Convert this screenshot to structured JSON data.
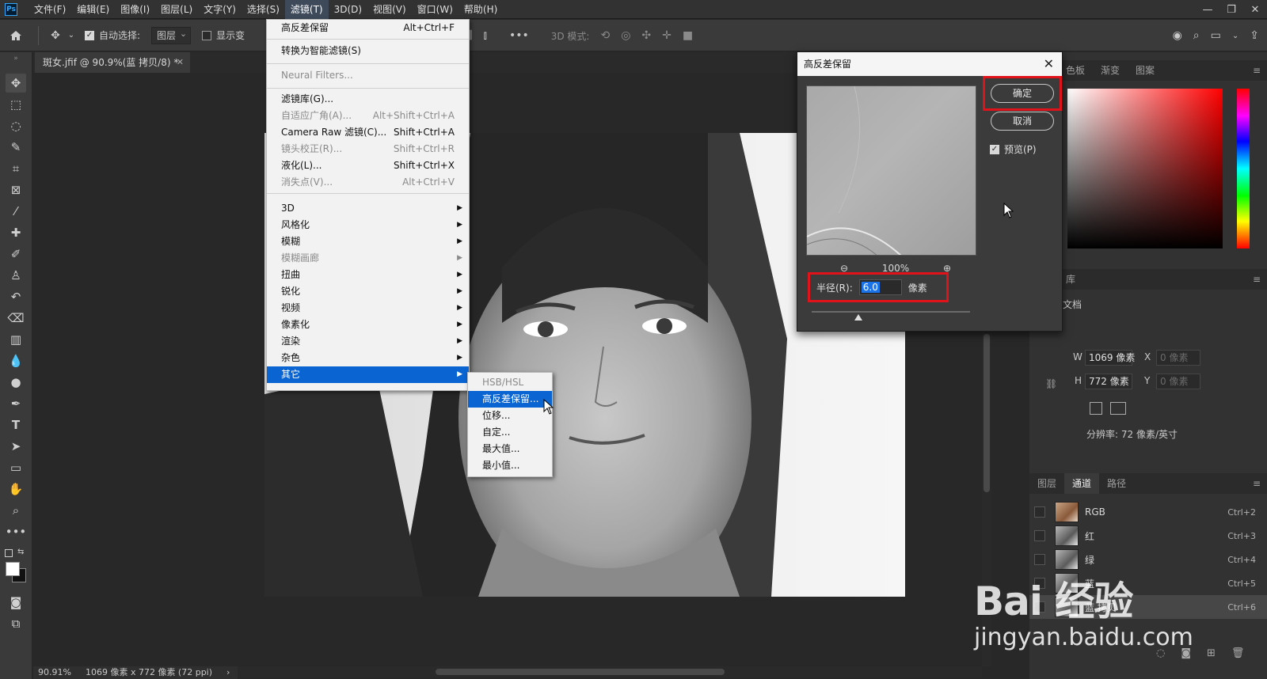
{
  "app": {
    "logo": "Ps"
  },
  "menubar": {
    "items": [
      "文件(F)",
      "编辑(E)",
      "图像(I)",
      "图层(L)",
      "文字(Y)",
      "选择(S)",
      "滤镜(T)",
      "3D(D)",
      "视图(V)",
      "窗口(W)",
      "帮助(H)"
    ],
    "active": "滤镜(T)"
  },
  "options": {
    "auto_select_label": "自动选择:",
    "auto_select_value": "图层",
    "show_transform_label": "显示变",
    "mode_3d_label": "3D 模式:"
  },
  "tab": {
    "title": "斑女.jfif @ 90.9%(蓝 拷贝/8) *"
  },
  "filter_menu": {
    "items": [
      {
        "label": "高反差保留",
        "shortcut": "Alt+Ctrl+F",
        "disabled": false
      },
      {
        "label": "转换为智能滤镜(S)",
        "shortcut": "",
        "disabled": false
      },
      {
        "label": "Neural Filters...",
        "shortcut": "",
        "disabled": true
      },
      {
        "label": "滤镜库(G)...",
        "shortcut": "",
        "disabled": false
      },
      {
        "label": "自适应广角(A)...",
        "shortcut": "Alt+Shift+Ctrl+A",
        "disabled": true
      },
      {
        "label": "Camera Raw 滤镜(C)...",
        "shortcut": "Shift+Ctrl+A",
        "disabled": false
      },
      {
        "label": "镜头校正(R)...",
        "shortcut": "Shift+Ctrl+R",
        "disabled": true
      },
      {
        "label": "液化(L)...",
        "shortcut": "Shift+Ctrl+X",
        "disabled": false
      },
      {
        "label": "消失点(V)...",
        "shortcut": "Alt+Ctrl+V",
        "disabled": true
      }
    ],
    "submenus": [
      {
        "label": "3D",
        "disabled": false
      },
      {
        "label": "风格化",
        "disabled": false
      },
      {
        "label": "模糊",
        "disabled": false
      },
      {
        "label": "模糊画廊",
        "disabled": true
      },
      {
        "label": "扭曲",
        "disabled": false
      },
      {
        "label": "锐化",
        "disabled": false
      },
      {
        "label": "视频",
        "disabled": false
      },
      {
        "label": "像素化",
        "disabled": false
      },
      {
        "label": "渲染",
        "disabled": false
      },
      {
        "label": "杂色",
        "disabled": false
      },
      {
        "label": "其它",
        "disabled": false,
        "highlighted": true
      }
    ]
  },
  "other_submenu": {
    "items": [
      {
        "label": "HSB/HSL",
        "disabled": true
      },
      {
        "label": "高反差保留...",
        "highlighted": true
      },
      {
        "label": "位移..."
      },
      {
        "label": "自定..."
      },
      {
        "label": "最大值..."
      },
      {
        "label": "最小值..."
      }
    ]
  },
  "dialog": {
    "title": "高反差保留",
    "ok_label": "确定",
    "cancel_label": "取消",
    "preview_label": "预览(P)",
    "preview_checked": true,
    "zoom": "100%",
    "radius_label": "半径(R):",
    "radius_value": "6.0",
    "radius_unit": "像素"
  },
  "right_panel": {
    "color_tabs": [
      "色板",
      "渐变",
      "图案"
    ],
    "library_tab": "库",
    "doc_label": "文档",
    "w_label": "W",
    "w_value": "1069 像素",
    "h_label": "H",
    "h_value": "772 像素",
    "x_label": "X",
    "x_placeholder": "0 像素",
    "y_label": "Y",
    "y_placeholder": "0 像素",
    "resolution": "分辨率: 72 像素/英寸",
    "layer_tabs": [
      "图层",
      "通道",
      "路径"
    ],
    "active_layer_tab": "通道",
    "channels": [
      {
        "name": "RGB",
        "shortcut": "Ctrl+2"
      },
      {
        "name": "红",
        "shortcut": "Ctrl+3"
      },
      {
        "name": "绿",
        "shortcut": "Ctrl+4"
      },
      {
        "name": "蓝",
        "shortcut": "Ctrl+5"
      },
      {
        "name": "蓝 拷贝",
        "shortcut": "Ctrl+6"
      }
    ]
  },
  "status": {
    "zoom": "90.91%",
    "doc_info": "1069 像素 x 772 像素 (72 ppi)"
  },
  "watermark": {
    "logo": "Bai 经验",
    "url": "jingyan.baidu.com"
  },
  "colors": {
    "accent": "#0a64d2",
    "highlight_box": "#e2121b"
  }
}
